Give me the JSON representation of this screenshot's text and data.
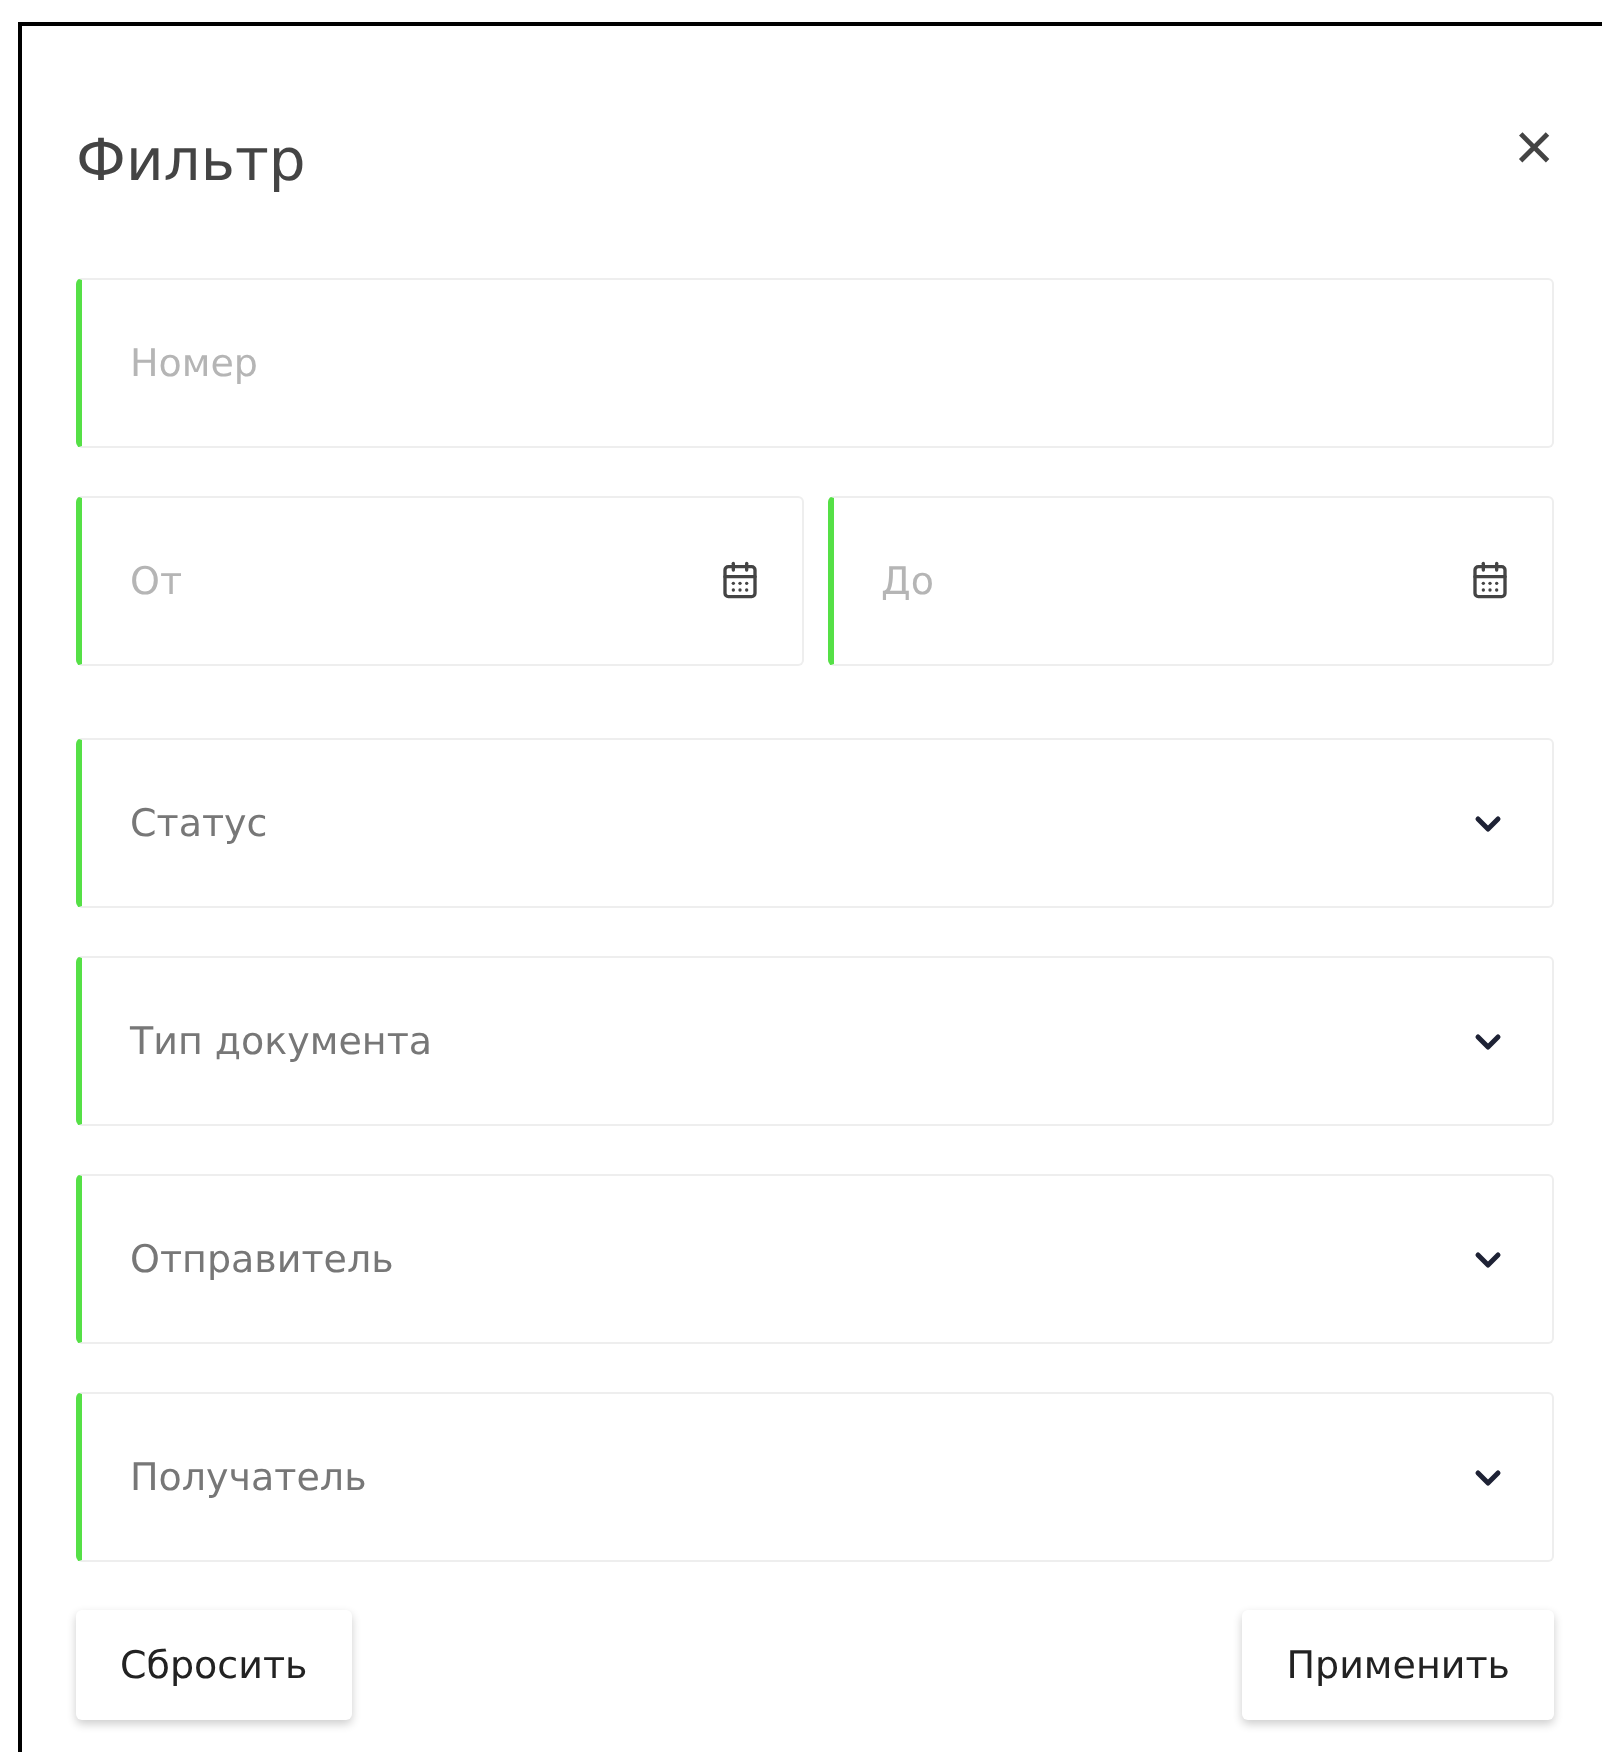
{
  "dialog": {
    "title": "Фильтр",
    "close": "×"
  },
  "fields": [
    {
      "kind": "text",
      "placeholder": "Номер"
    },
    {
      "kind": "date_range",
      "from": {
        "placeholder": "От"
      },
      "to": {
        "placeholder": "До"
      }
    },
    {
      "kind": "select",
      "placeholder": "Статус"
    },
    {
      "kind": "select",
      "placeholder": "Тип документа"
    },
    {
      "kind": "select",
      "placeholder": "Отправитель"
    },
    {
      "kind": "select",
      "placeholder": "Получатель"
    }
  ],
  "buttons": [
    {
      "label": "Сбросить"
    },
    {
      "label": "Применить"
    }
  ]
}
